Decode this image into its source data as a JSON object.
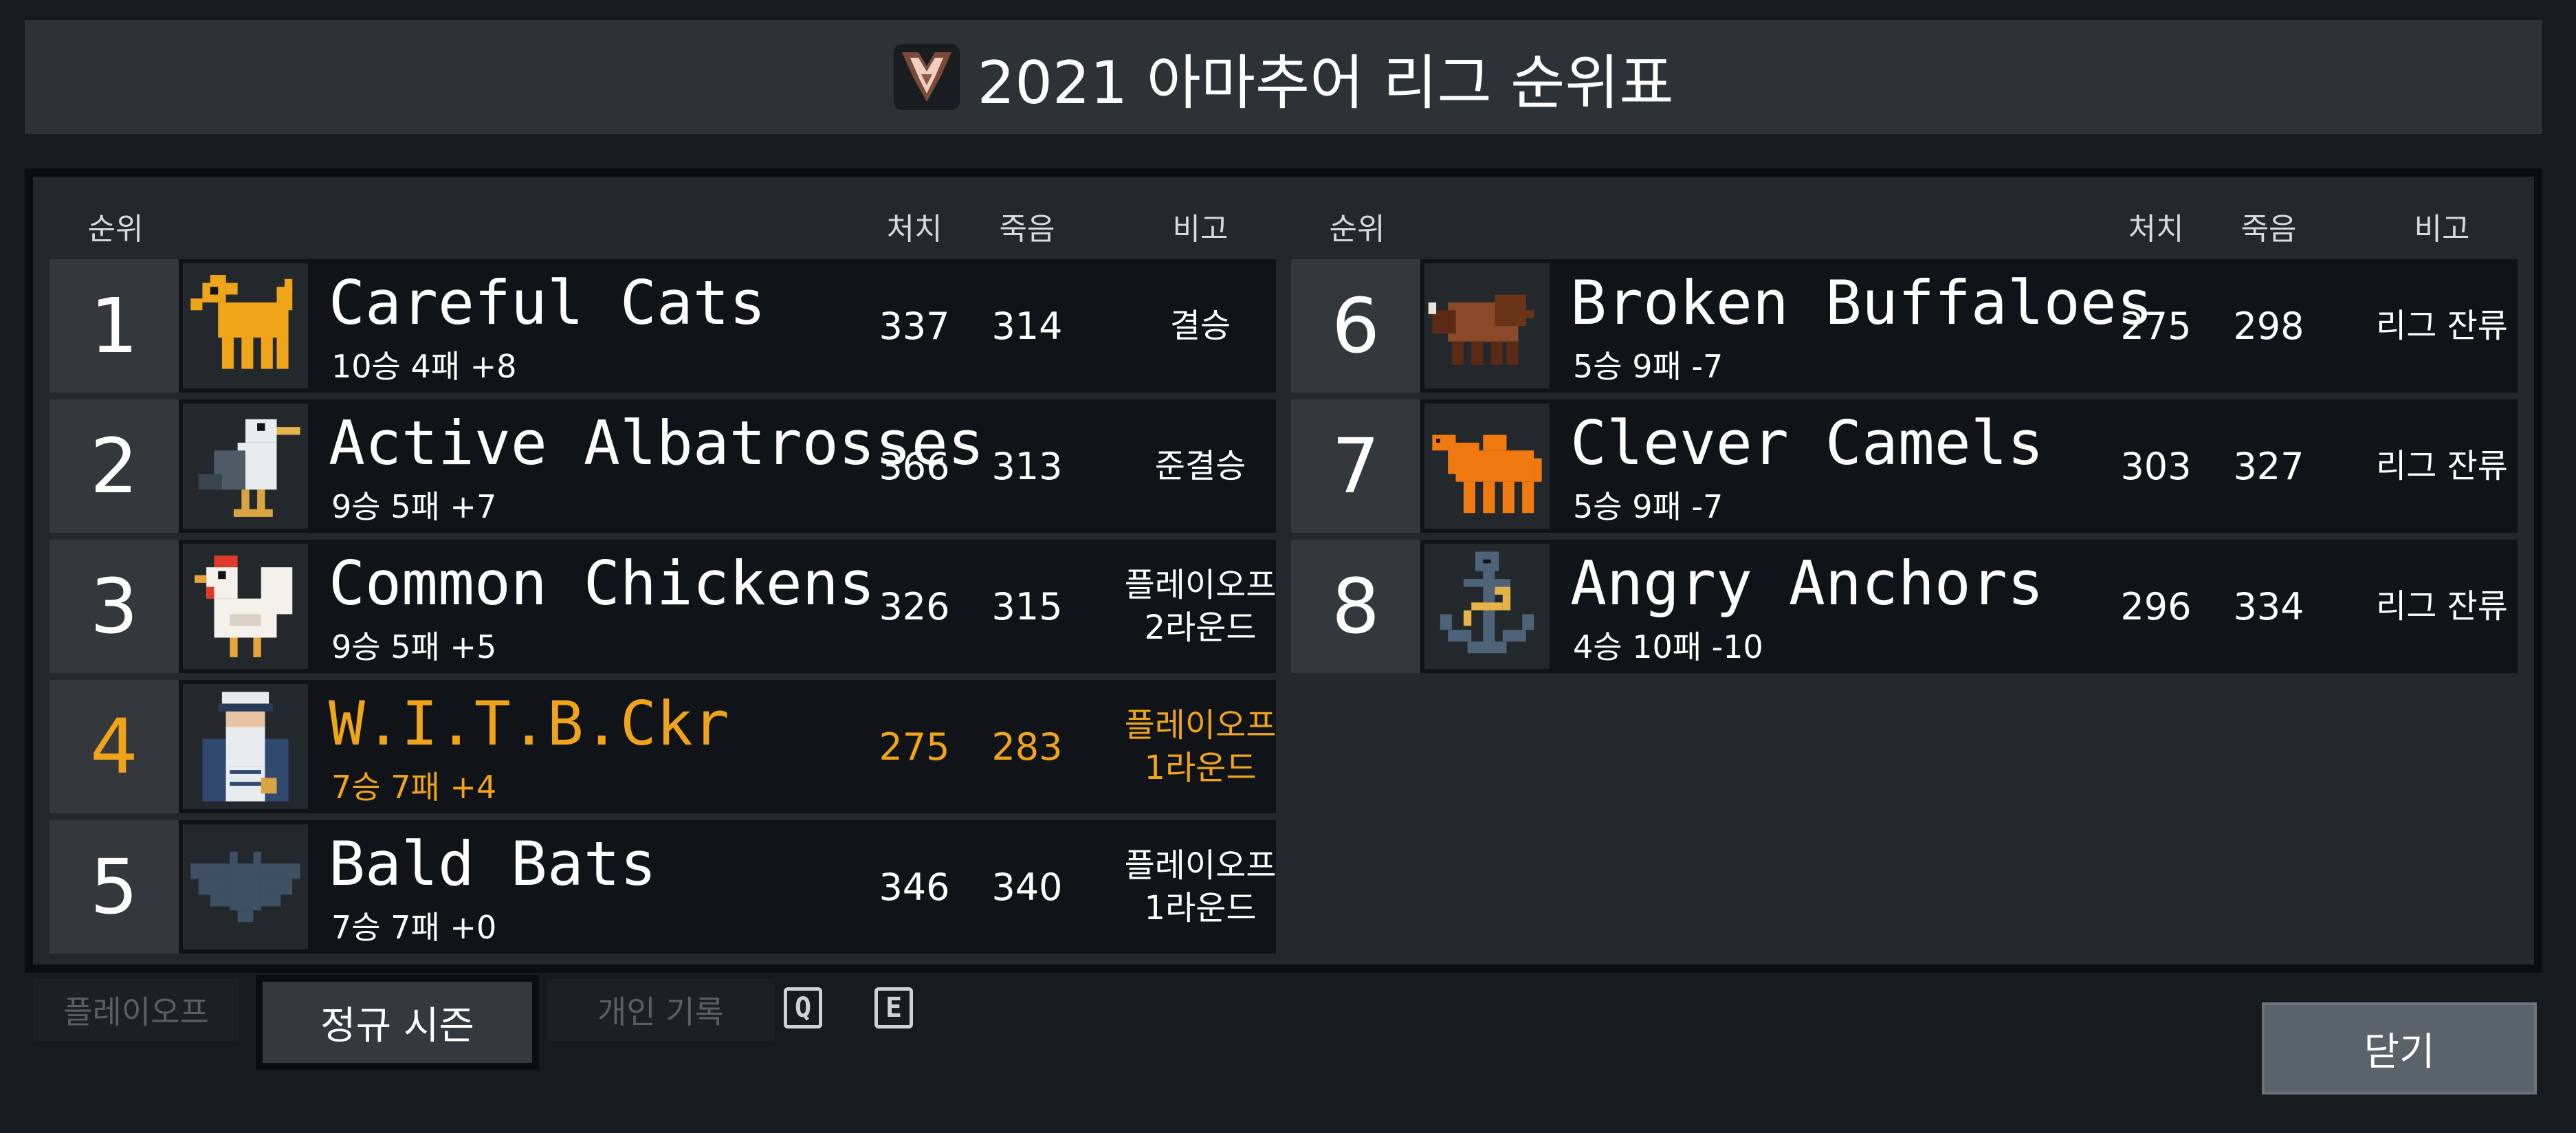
{
  "title": "2021 아마추어 리그 순위표",
  "colors": {
    "highlight": "#f0a419",
    "panel": "#2d3236",
    "row": "#101317"
  },
  "headers": {
    "rank": "순위",
    "kills": "처치",
    "deaths": "죽음",
    "notes": "비고"
  },
  "teams": [
    {
      "rank": "1",
      "name": "Careful Cats",
      "record": "10승 4패 +8",
      "kills": "337",
      "deaths": "314",
      "note": "결승",
      "icon": "cat-icon"
    },
    {
      "rank": "2",
      "name": "Active Albatrosses",
      "record": "9승 5패 +7",
      "kills": "366",
      "deaths": "313",
      "note": "준결승",
      "icon": "albatross-icon"
    },
    {
      "rank": "3",
      "name": "Common Chickens",
      "record": "9승 5패 +5",
      "kills": "326",
      "deaths": "315",
      "note": "플레이오프\n2라운드",
      "icon": "chicken-icon"
    },
    {
      "rank": "4",
      "name": "W.I.T.B.Ckr",
      "record": "7승 7패 +4",
      "kills": "275",
      "deaths": "283",
      "note": "플레이오프\n1라운드",
      "icon": "sailor-icon",
      "highlight": true
    },
    {
      "rank": "5",
      "name": "Bald Bats",
      "record": "7승 7패 +0",
      "kills": "346",
      "deaths": "340",
      "note": "플레이오프\n1라운드",
      "icon": "bat-icon"
    },
    {
      "rank": "6",
      "name": "Broken Buffaloes",
      "record": "5승 9패 -7",
      "kills": "275",
      "deaths": "298",
      "note": "리그 잔류",
      "icon": "buffalo-icon"
    },
    {
      "rank": "7",
      "name": "Clever Camels",
      "record": "5승 9패 -7",
      "kills": "303",
      "deaths": "327",
      "note": "리그 잔류",
      "icon": "camel-icon"
    },
    {
      "rank": "8",
      "name": "Angry Anchors",
      "record": "4승 10패 -10",
      "kills": "296",
      "deaths": "334",
      "note": "리그 잔류",
      "icon": "anchor-icon"
    }
  ],
  "tabs": {
    "playoff": "플레이오프",
    "regular": "정규 시즌",
    "personal": "개인 기록"
  },
  "keys": {
    "q": "Q",
    "e": "E"
  },
  "close_label": "닫기"
}
